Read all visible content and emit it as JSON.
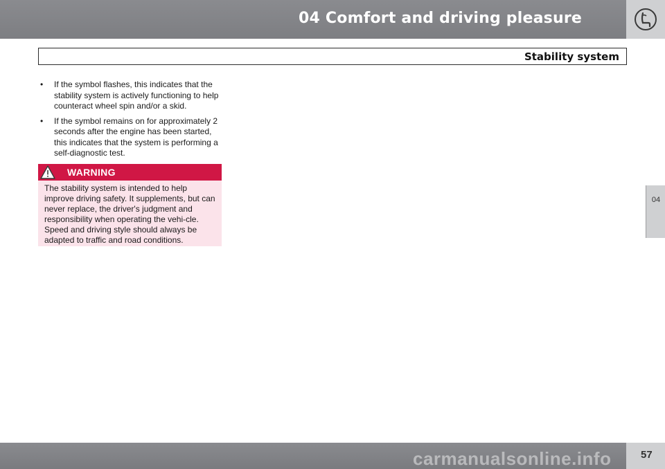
{
  "header": {
    "chapter_title": "04 Comfort and driving pleasure",
    "icon": "seat-icon"
  },
  "section": {
    "title": "Stability system"
  },
  "side_tab": {
    "label": "04"
  },
  "bullets": [
    {
      "marker": "•",
      "text": "If the symbol flashes, this indicates that the stability system is actively functioning to help counteract wheel spin and/or a skid."
    },
    {
      "marker": "•",
      "text": "If the symbol remains on for approximately 2 seconds after the engine has been started, this indicates that the system is performing a self-diagnostic test."
    }
  ],
  "warning": {
    "label": "WARNING",
    "icon": "warning-triangle-icon",
    "body": "The stability system is intended to help improve driving safety. It supplements, but can never replace, the driver's judgment and responsibility when operating the vehi-cle. Speed and driving style should always be adapted to traffic and road conditions."
  },
  "footer": {
    "page_number": "57",
    "watermark": "carmanualsonline.info"
  },
  "colors": {
    "header_gray": "#8a8b8f",
    "tab_gray": "#cfd0d2",
    "warning_red": "#d01745",
    "warning_pink": "#fbe3ea"
  }
}
